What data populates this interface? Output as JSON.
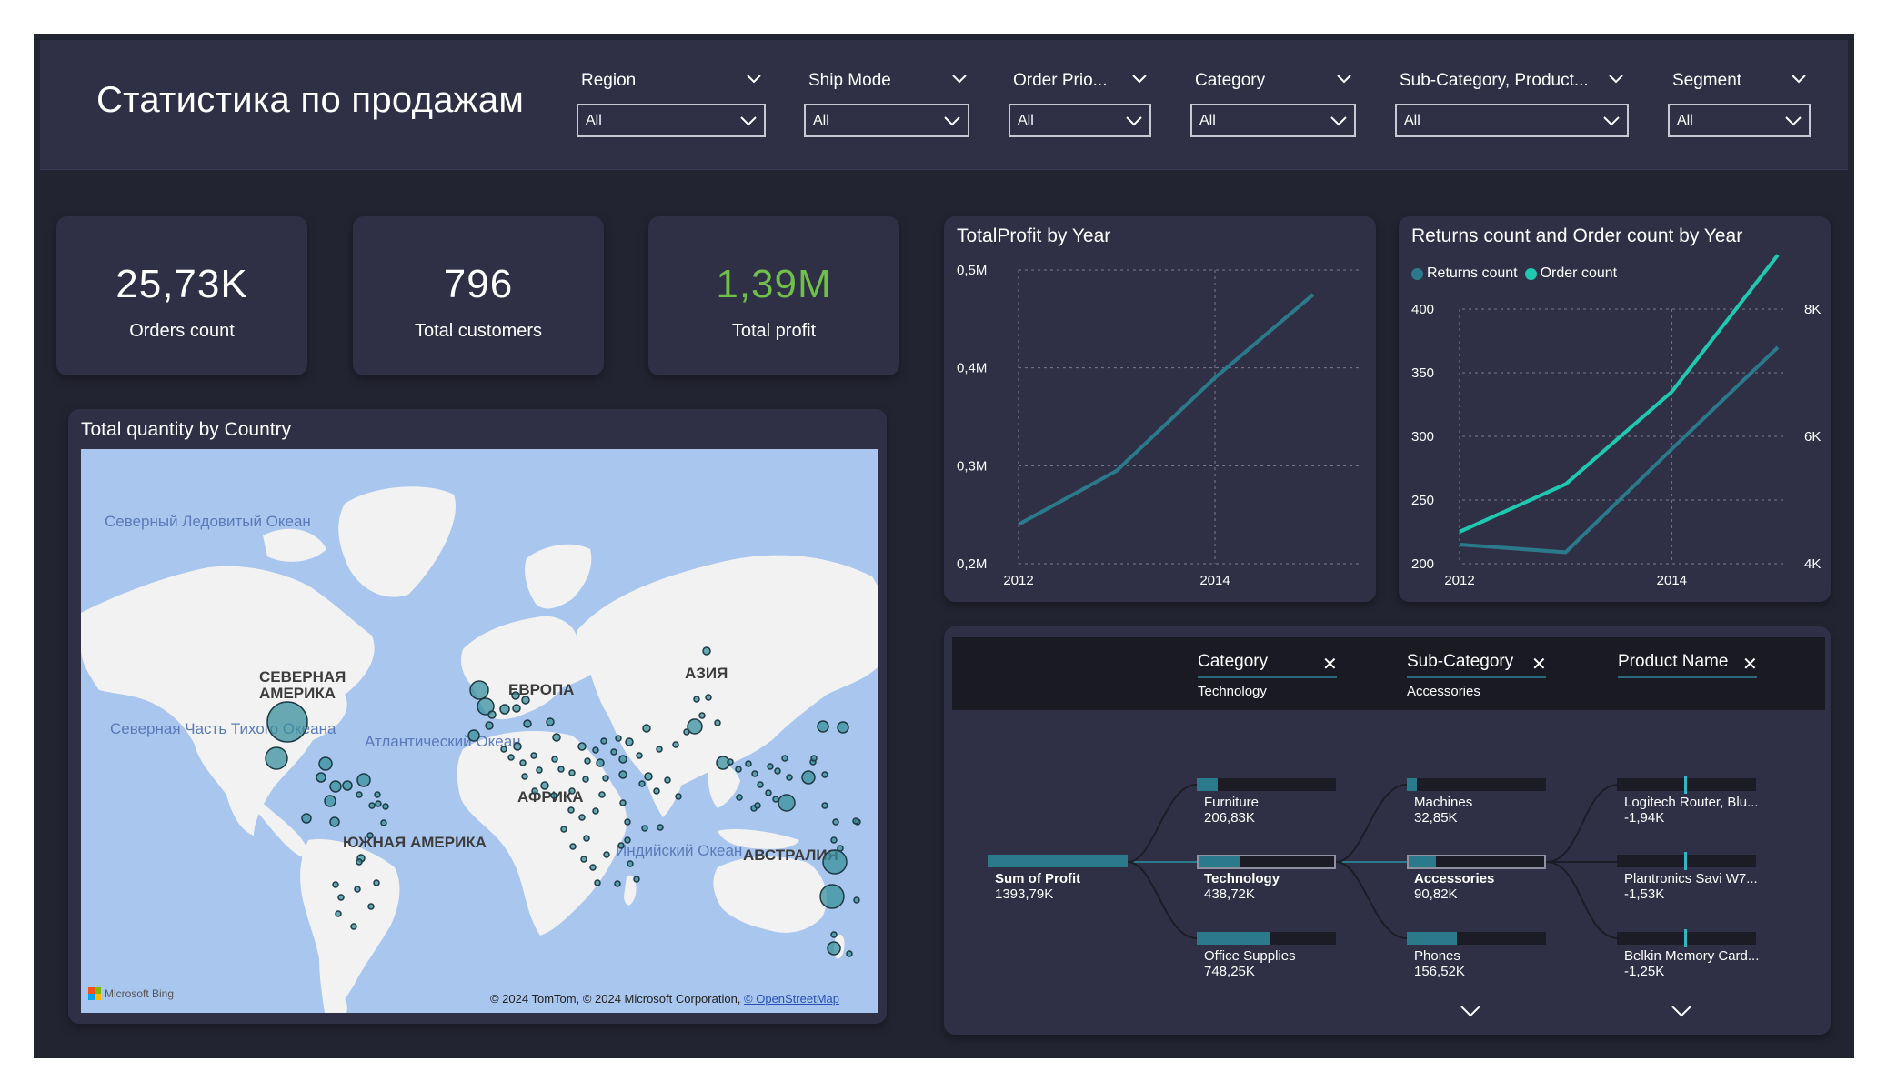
{
  "header": {
    "title": "Статистика по продажам",
    "slicers": [
      {
        "label": "Region",
        "value": "All"
      },
      {
        "label": "Ship Mode",
        "value": "All"
      },
      {
        "label": "Order Prio...",
        "value": "All"
      },
      {
        "label": "Category",
        "value": "All"
      },
      {
        "label": "Sub-Category, Product...",
        "value": "All"
      },
      {
        "label": "Segment",
        "value": "All"
      }
    ]
  },
  "kpis": [
    {
      "value": "25,73K",
      "label": "Orders count",
      "color": "#ffffff"
    },
    {
      "value": "796",
      "label": "Total customers",
      "color": "#ffffff"
    },
    {
      "value": "1,39M",
      "label": "Total profit",
      "color": "#6fbf4a"
    }
  ],
  "map": {
    "title": "Total quantity by Country",
    "continents": [
      "СЕВЕРНАЯ\nАМЕРИКА",
      "ЕВРОПА",
      "АЗИЯ",
      "АФРИКА",
      "ЮЖНАЯ АМЕРИКА",
      "АВСТРАЛИЯ"
    ],
    "oceans": [
      "Северный\nЛедовитый\nОкеан",
      "Северная\nЧасть\nТихого\nОкеана",
      "Атлантический\nОкеан",
      "Индийский\nОкеан"
    ],
    "credit_text": "© 2024 TomTom, © 2024 Microsoft Corporation, ",
    "credit_link": "© OpenStreetMap",
    "logo_text": "Microsoft Bing",
    "bubble_color": "#3a8f9c"
  },
  "profit_chart": {
    "title": "TotalProfit by Year",
    "chart_data": {
      "type": "line",
      "x": [
        2012,
        2013,
        2014,
        2015
      ],
      "series": [
        {
          "values": [
            240000,
            295000,
            390000,
            475000
          ]
        }
      ],
      "x_tick_labels": [
        "2012",
        "2014"
      ],
      "y_tick_labels": [
        "0,5M",
        "0,4M",
        "0,3M",
        "0,2M"
      ],
      "ylim": [
        200000,
        500000
      ],
      "grid": true,
      "line_color": "#2a7a8c"
    }
  },
  "returns_chart": {
    "title": "Returns count and Order count by Year",
    "legend": [
      {
        "name": "Returns count",
        "color": "#2a7a8c"
      },
      {
        "name": "Order count",
        "color": "#1fc9b0"
      }
    ],
    "chart_data": {
      "type": "line",
      "x": [
        2012,
        2013,
        2014,
        2015
      ],
      "series": [
        {
          "name": "Returns count",
          "axis": "left",
          "values": [
            215,
            209,
            290,
            370
          ],
          "color": "#2a7a8c"
        },
        {
          "name": "Order count",
          "axis": "right",
          "values": [
            4500,
            5250,
            6700,
            8850
          ],
          "color": "#1fc9b0"
        }
      ],
      "x_tick_labels": [
        "2012",
        "2014"
      ],
      "y_left_tick_labels": [
        "400",
        "350",
        "300",
        "250",
        "200"
      ],
      "y_right_tick_labels": [
        "8K",
        "6K",
        "4K"
      ],
      "ylim_left": [
        200,
        400
      ],
      "ylim_right": [
        4000,
        8000
      ],
      "grid": true
    }
  },
  "decomp_tree": {
    "columns": [
      {
        "title": "Category",
        "selected": "Technology"
      },
      {
        "title": "Sub-Category",
        "selected": "Accessories"
      },
      {
        "title": "Product Name",
        "selected": ""
      }
    ],
    "root": {
      "name": "Sum of Profit",
      "value": "1393,79K",
      "fraction": 1.0
    },
    "categories": [
      {
        "name": "Furniture",
        "value": "206,83K",
        "fraction": 0.15
      },
      {
        "name": "Technology",
        "value": "438,72K",
        "fraction": 0.31
      },
      {
        "name": "Office Supplies",
        "value": "748,25K",
        "fraction": 0.53
      }
    ],
    "subcategories": [
      {
        "name": "Machines",
        "value": "32,85K",
        "fraction": 0.07
      },
      {
        "name": "Accessories",
        "value": "90,82K",
        "fraction": 0.21
      },
      {
        "name": "Phones",
        "value": "156,52K",
        "fraction": 0.36
      }
    ],
    "products": [
      {
        "name": "Logitech Router, Blu...",
        "value": "-1,94K"
      },
      {
        "name": "Plantronics Savi W7...",
        "value": "-1,53K"
      },
      {
        "name": "Belkin Memory Card...",
        "value": "-1,25K"
      }
    ]
  }
}
